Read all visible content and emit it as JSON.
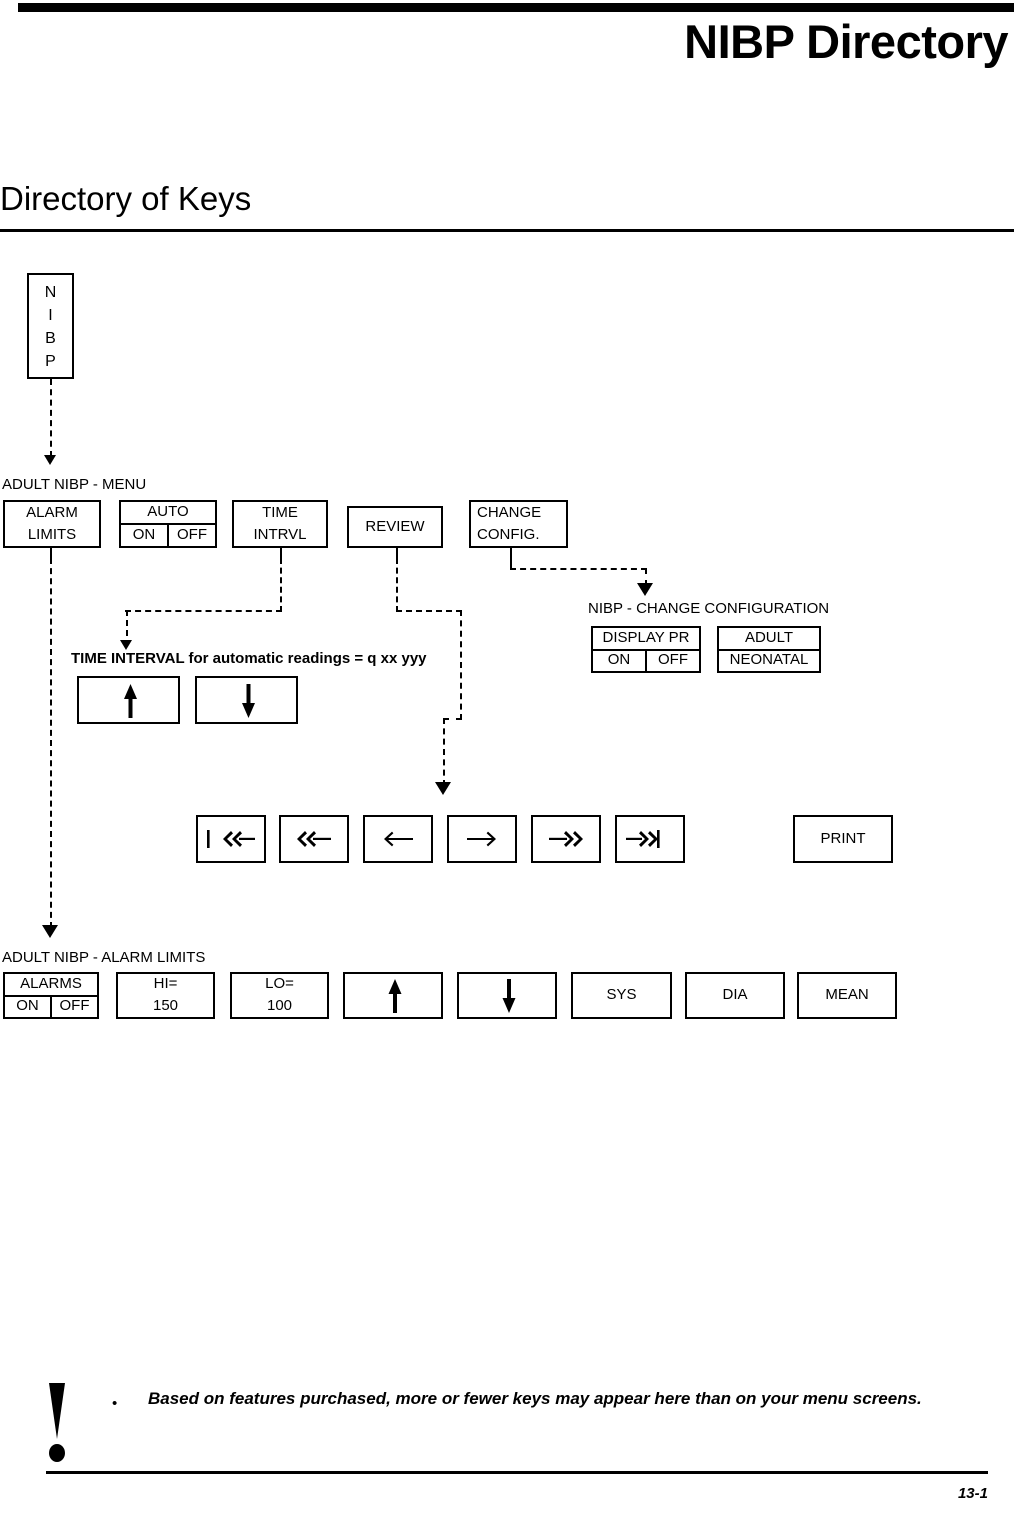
{
  "header": {
    "title": "NIBP Directory",
    "section_title": "Directory of Keys"
  },
  "diagram": {
    "root_key": {
      "name": "nibp-key",
      "letters": [
        "N",
        "I",
        "B",
        "P"
      ]
    },
    "menu_section": {
      "label": "ADULT NIBP - MENU",
      "keys": [
        {
          "name": "alarm-limits",
          "line1": "ALARM",
          "line2": "LIMITS"
        },
        {
          "name": "auto",
          "header": "AUTO",
          "options": [
            "ON",
            "OFF"
          ]
        },
        {
          "name": "time-intrvl",
          "line1": "TIME",
          "line2": "INTRVL"
        },
        {
          "name": "review",
          "line1": "REVIEW"
        },
        {
          "name": "change-config",
          "line1": "CHANGE",
          "line2": "CONFIG."
        }
      ]
    },
    "time_interval_section": {
      "label": "TIME INTERVAL for automatic readings = q xx yyy",
      "keys": [
        {
          "name": "increase",
          "icon": "arrow-up-icon"
        },
        {
          "name": "decrease",
          "icon": "arrow-down-icon"
        }
      ]
    },
    "change_config_section": {
      "label": "NIBP - CHANGE CONFIGURATION",
      "keys": [
        {
          "name": "display-pr",
          "header": "DISPLAY PR",
          "options": [
            "ON",
            "OFF"
          ]
        },
        {
          "name": "patient-mode",
          "options": [
            "ADULT",
            "NEONATAL"
          ]
        }
      ]
    },
    "review_section": {
      "keys": [
        {
          "name": "first-page",
          "icon": "first-page-icon"
        },
        {
          "name": "rewind",
          "icon": "rewind-icon"
        },
        {
          "name": "back",
          "icon": "arrow-left-icon"
        },
        {
          "name": "forward",
          "icon": "arrow-right-icon"
        },
        {
          "name": "fast-forward",
          "icon": "fast-forward-icon"
        },
        {
          "name": "last-page",
          "icon": "last-page-icon"
        },
        {
          "name": "print",
          "label": "PRINT"
        }
      ]
    },
    "alarm_limits_section": {
      "label": "ADULT NIBP - ALARM LIMITS",
      "keys": [
        {
          "name": "alarms",
          "header": "ALARMS",
          "options": [
            "ON",
            "OFF"
          ]
        },
        {
          "name": "hi-limit",
          "line1": "HI=",
          "line2": "150"
        },
        {
          "name": "lo-limit",
          "line1": "LO=",
          "line2": "100"
        },
        {
          "name": "increase",
          "icon": "arrow-up-icon"
        },
        {
          "name": "decrease",
          "icon": "arrow-down-icon"
        },
        {
          "name": "sys",
          "line1": "SYS"
        },
        {
          "name": "dia",
          "line1": "DIA"
        },
        {
          "name": "mean",
          "line1": "MEAN"
        }
      ]
    }
  },
  "footer": {
    "bullet": "•",
    "note": "Based on features purchased, more or fewer keys may appear here than on your menu screens.",
    "page_number": "13-1"
  }
}
